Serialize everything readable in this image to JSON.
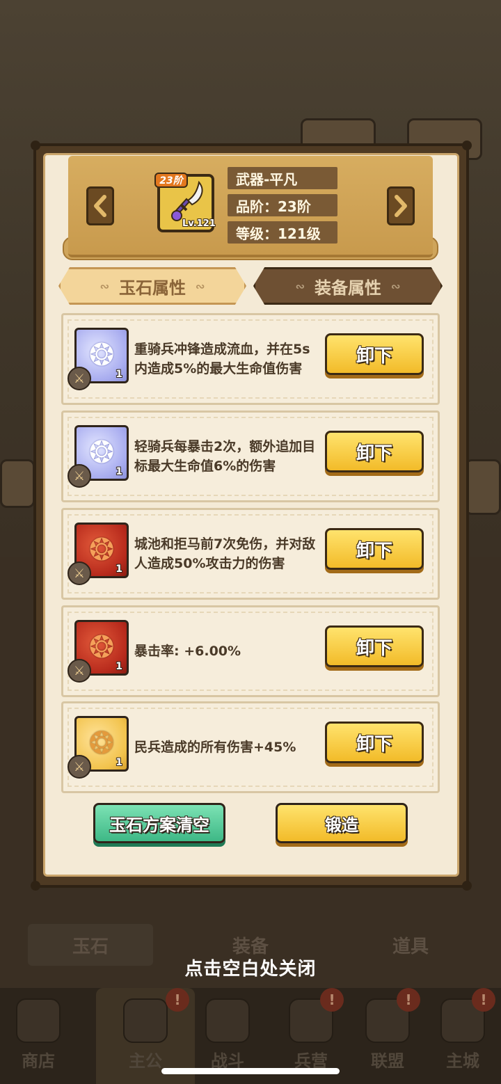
{
  "background": {
    "bottom_tabs": [
      "玉石",
      "装备",
      "道具"
    ],
    "nav": [
      {
        "label": "商店",
        "badge": ""
      },
      {
        "label": "主公",
        "badge": "!"
      },
      {
        "label": "战斗",
        "badge": ""
      },
      {
        "label": "兵营",
        "badge": "!"
      },
      {
        "label": "联盟",
        "badge": "!"
      },
      {
        "label": "主城",
        "badge": "!"
      }
    ],
    "close_hint": "点击空白处关闭"
  },
  "header": {
    "prev_icon": "chevron-left-icon",
    "next_icon": "chevron-right-icon",
    "weapon_tier_badge": "23阶",
    "weapon_level": "Lv.121",
    "name": "武器-平凡",
    "tier": "品阶：23阶",
    "level": "等级：121级"
  },
  "tabs": {
    "jade": "玉石属性",
    "equip": "装备属性"
  },
  "gems": [
    {
      "color": "blue",
      "count": "1",
      "desc": "重骑兵冲锋造成流血，并在5s内造成5%的最大生命值伤害",
      "button": "卸下"
    },
    {
      "color": "blue",
      "count": "1",
      "desc": "轻骑兵每暴击2次，额外追加目标最大生命值6%的伤害",
      "button": "卸下"
    },
    {
      "color": "red",
      "count": "1",
      "desc": "城池和拒马前7次免伤，并对敌人造成50%攻击力的伤害",
      "button": "卸下"
    },
    {
      "color": "red",
      "count": "1",
      "desc": "暴击率: +6.00%",
      "button": "卸下"
    },
    {
      "color": "gold",
      "count": "1",
      "desc": "民兵造成的所有伤害+45%",
      "button": "卸下"
    }
  ],
  "footer": {
    "clear": "玉石方案清空",
    "forge": "锻造"
  }
}
